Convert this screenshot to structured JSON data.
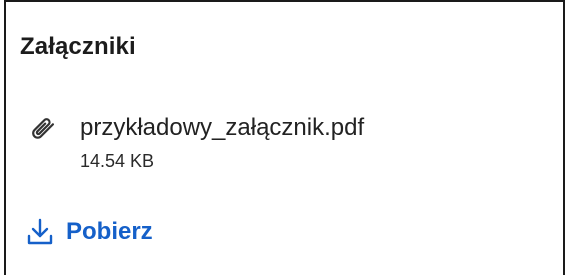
{
  "attachments": {
    "title": "Załączniki",
    "file": {
      "name": "przykładowy_załącznik.pdf",
      "size": "14.54 KB",
      "icon": "paperclip-icon"
    },
    "download": {
      "label": "Pobierz",
      "icon": "download-icon",
      "color": "#1560c9"
    }
  }
}
